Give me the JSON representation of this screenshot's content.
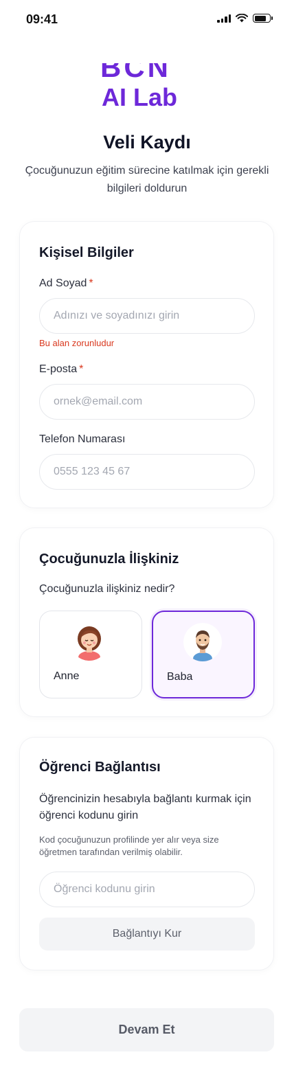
{
  "status": {
    "time": "09:41"
  },
  "logo": {
    "top_text": "BCN",
    "bottom_text": "AI Lab"
  },
  "header": {
    "title": "Veli Kaydı",
    "subtitle": "Çocuğunuzun eğitim sürecine katılmak için gerekli bilgileri doldurun"
  },
  "personal": {
    "title": "Kişisel Bilgiler",
    "name_label": "Ad Soyad",
    "name_placeholder": "Adınızı ve soyadınızı girin",
    "name_error": "Bu alan zorunludur",
    "email_label": "E-posta",
    "email_placeholder": "ornek@email.com",
    "phone_label": "Telefon Numarası",
    "phone_placeholder": "0555 123 45 67",
    "required_mark": "*"
  },
  "relationship": {
    "title": "Çocuğunuzla İlişkiniz",
    "question": "Çocuğunuzla ilişkiniz nedir?",
    "options": [
      {
        "label": "Anne",
        "icon": "mother-avatar-icon",
        "selected": false
      },
      {
        "label": "Baba",
        "icon": "father-avatar-icon",
        "selected": true
      }
    ]
  },
  "student": {
    "title": "Öğrenci Bağlantısı",
    "description": "Öğrencinizin hesabıyla bağlantı kurmak için öğrenci kodunu girin",
    "hint": "Kod çocuğunuzun profilinde yer alır veya size öğretmen tarafından verilmiş olabilir.",
    "code_placeholder": "Öğrenci kodunu girin",
    "connect_label": "Bağlantıyı Kur"
  },
  "footer": {
    "continue_label": "Devam Et"
  },
  "colors": {
    "accent": "#6d28d9",
    "error": "#d9381e",
    "selected_bg": "#faf5ff",
    "button_bg": "#f3f4f6"
  }
}
